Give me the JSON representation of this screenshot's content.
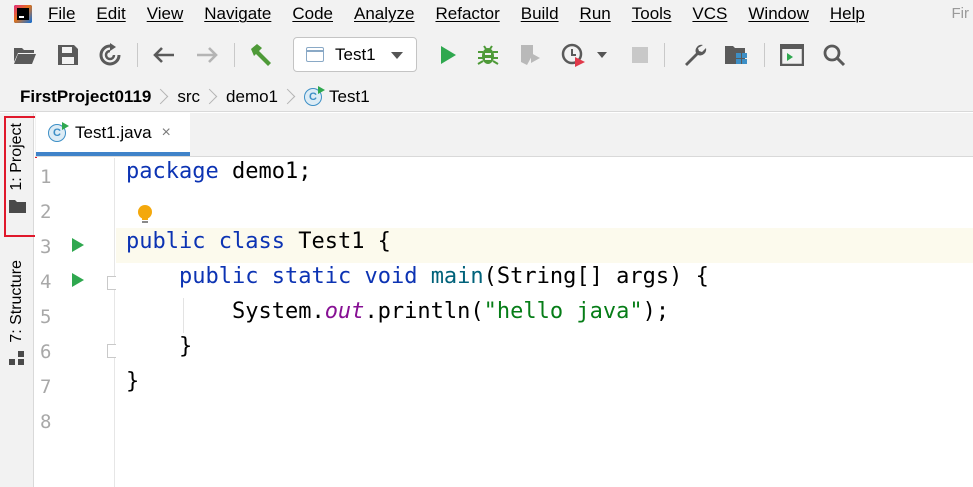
{
  "menu": {
    "items": [
      "File",
      "Edit",
      "View",
      "Navigate",
      "Code",
      "Analyze",
      "Refactor",
      "Build",
      "Run",
      "Tools",
      "VCS",
      "Window",
      "Help"
    ],
    "trailing": "Fir"
  },
  "toolbar": {
    "run_config": "Test1"
  },
  "breadcrumb": {
    "project": "FirstProject0119",
    "folder1": "src",
    "folder2": "demo1",
    "class": "Test1"
  },
  "side": {
    "project_tab": "1: Project",
    "structure_tab": "7: Structure"
  },
  "editor": {
    "tab_label": "Test1.java",
    "tab_close": "×",
    "line_numbers": [
      "1",
      "2",
      "3",
      "4",
      "5",
      "6",
      "7",
      "8"
    ],
    "lines": {
      "l1_kw": "package",
      "l1_rest": " demo1;",
      "l3_kw1": "public",
      "l3_kw2": "class",
      "l3_rest": " Test1 {",
      "l4_indent": "    ",
      "l4_kw1": "public",
      "l4_kw2": "static",
      "l4_kw3": "void",
      "l4_fn": "main",
      "l4_rest": "(String[] args) {",
      "l5_indent": "        ",
      "l5_obj": "System.",
      "l5_field": "out",
      "l5_call": ".println(",
      "l5_str": "\"hello java\"",
      "l5_end": ");",
      "l6": "    }",
      "l7": "}"
    }
  },
  "colors": {
    "keyword": "#0c33b3",
    "method": "#00627a",
    "string": "#067d17",
    "static_field": "#871094",
    "run_green": "#2fa84f",
    "tab_underline": "#4083c9",
    "highlight_red": "#e0182b"
  },
  "icons": [
    "app-logo-icon",
    "open-folder-icon",
    "save-icon",
    "sync-icon",
    "back-arrow-icon",
    "forward-arrow-icon",
    "build-hammer-icon",
    "run-config-icon",
    "run-icon",
    "debug-icon",
    "coverage-icon",
    "profile-icon",
    "stop-icon",
    "settings-wrench-icon",
    "project-structure-icon",
    "terminal-icon",
    "search-icon",
    "class-icon",
    "folder-icon",
    "structure-icon",
    "lightbulb-icon"
  ]
}
